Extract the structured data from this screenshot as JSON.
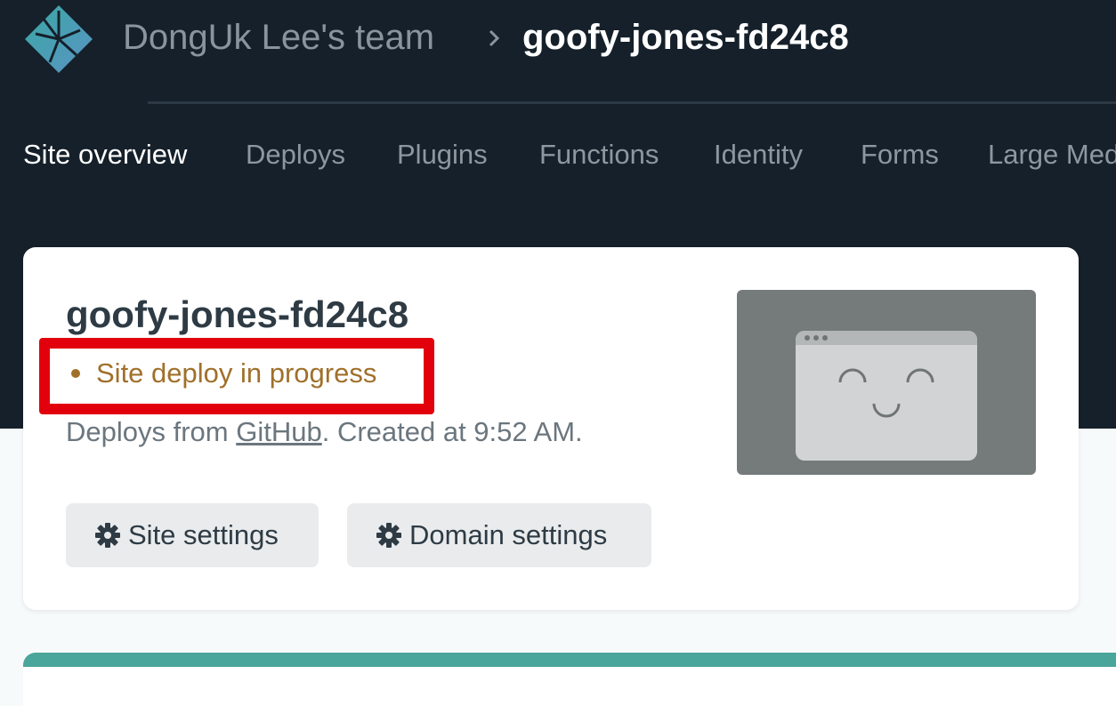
{
  "header": {
    "team_name": "DongUk Lee's team",
    "site_name": "goofy-jones-fd24c8"
  },
  "nav": {
    "items": [
      {
        "label": "Site overview",
        "active": true
      },
      {
        "label": "Deploys"
      },
      {
        "label": "Plugins"
      },
      {
        "label": "Functions"
      },
      {
        "label": "Identity"
      },
      {
        "label": "Forms"
      },
      {
        "label": "Large Media"
      }
    ]
  },
  "site_card": {
    "title": "goofy-jones-fd24c8",
    "status": "Site deploy in progress",
    "deploys_from_prefix": "Deploys from ",
    "deploys_from_link": "GitHub",
    "created_text": ". Created at 9:52 AM.",
    "site_settings_label": "Site settings",
    "domain_settings_label": "Domain settings"
  },
  "colors": {
    "header_bg": "#15202a",
    "status": "#a0702a",
    "highlight_box": "#e2000d",
    "accent_teal": "#4aa59a"
  }
}
